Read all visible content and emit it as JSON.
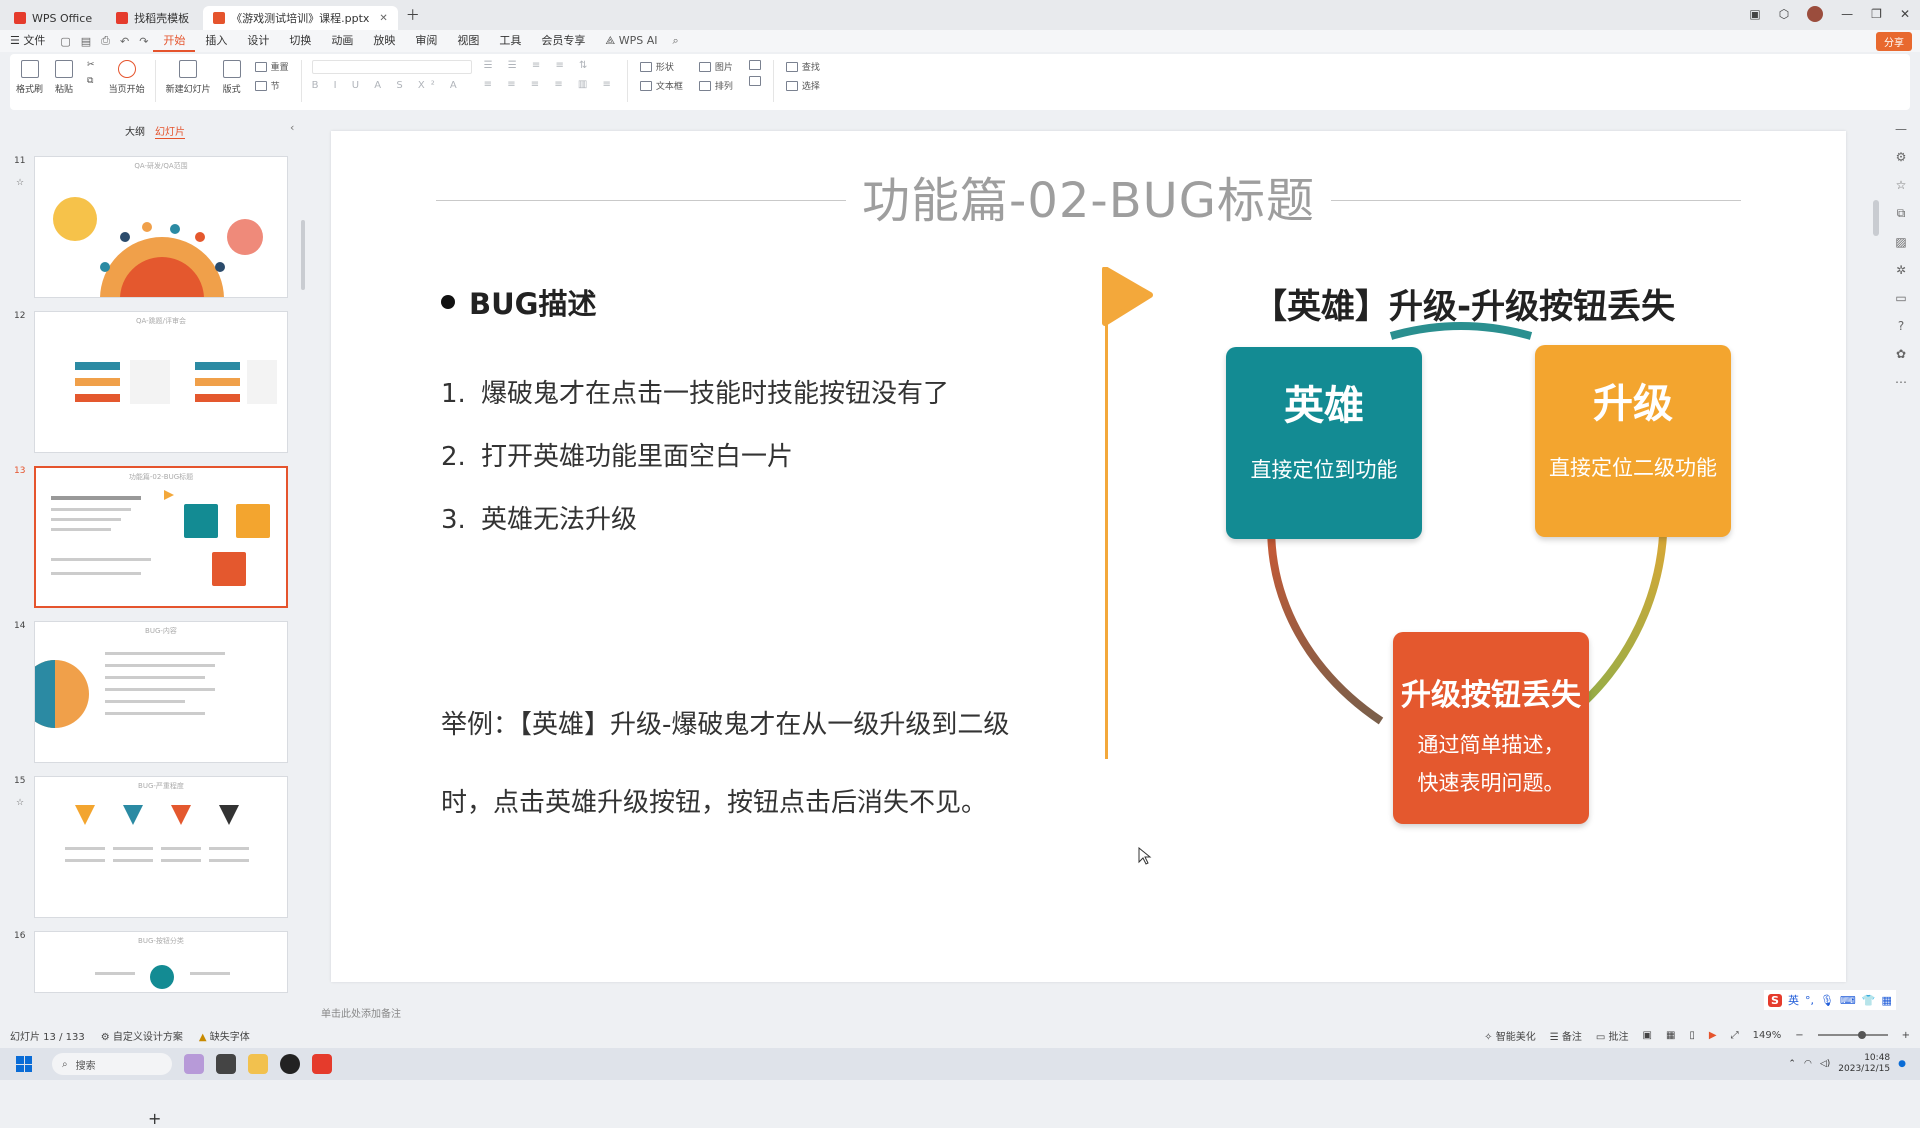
{
  "window": {
    "tabs": [
      {
        "label": "WPS Office",
        "color": "#e53b2c"
      },
      {
        "label": "找稻壳模板",
        "color": "#e53b2c"
      },
      {
        "label": "《游戏测试培训》课程.pptx",
        "color": "#e5542d",
        "active": true
      }
    ]
  },
  "menubar": {
    "file": "文件",
    "items": [
      "开始",
      "插入",
      "设计",
      "切换",
      "动画",
      "放映",
      "审阅",
      "视图",
      "工具",
      "会员专享"
    ],
    "active": "开始",
    "wps_ai": "WPS AI",
    "share": "分享"
  },
  "ribbon": {
    "format_painter": "格式刷",
    "paste": "粘贴",
    "play_from_current": "当页开始",
    "new_slide": "新建幻灯片",
    "layout": "版式",
    "reset": "重置",
    "section": "节",
    "shape": "形状",
    "picture": "图片",
    "textbox": "文本框",
    "arrange": "排列",
    "find": "查找",
    "select": "选择"
  },
  "leftpanel": {
    "tab_outline": "大纲",
    "tab_slides": "幻灯片",
    "thumbs": [
      {
        "num": "11",
        "title": "QA-研发/QA范围"
      },
      {
        "num": "12",
        "title": "QA-跳题/评审会"
      },
      {
        "num": "13",
        "title": "功能篇-02-BUG标题",
        "selected": true
      },
      {
        "num": "14",
        "title": "BUG-内容"
      },
      {
        "num": "15",
        "title": "BUG-严重程度"
      },
      {
        "num": "16",
        "title": "BUG-按钮分类"
      }
    ],
    "add": "+"
  },
  "slide": {
    "title": "功能篇-02-BUG标题",
    "bug_heading": "BUG描述",
    "items": [
      {
        "n": "1.",
        "text": "爆破鬼才在点击一技能时技能按钮没有了"
      },
      {
        "n": "2.",
        "text": "打开英雄功能里面空白一片"
      },
      {
        "n": "3.",
        "text": "英雄无法升级"
      }
    ],
    "example_line1": "举例：【英雄】升级-爆破鬼才在从一级升级到二级",
    "example_line2": "时，点击英雄升级按钮，按钮点击后消失不见。",
    "right_title": "【英雄】升级-升级按钮丢失",
    "cards": {
      "teal": {
        "title": "英雄",
        "sub": "直接定位到功能",
        "color": "#138b93"
      },
      "orange": {
        "title": "升级",
        "sub": "直接定位二级功能",
        "color": "#f3a52f"
      },
      "red": {
        "title": "升级按钮丢失",
        "sub1": "通过简单描述，",
        "sub2": "快速表明问题。",
        "color": "#e4582e"
      }
    }
  },
  "notes_placeholder": "单击此处添加备注",
  "status": {
    "slide_counter": "幻灯片 13 / 133",
    "design": "自定义设计方案",
    "missing_font": "缺失字体",
    "smart": "智能美化",
    "notes": "备注",
    "comments": "批注",
    "zoom": "149%"
  },
  "taskbar": {
    "search": "搜索",
    "time": "10:48",
    "date": "2023/12/15"
  },
  "ime": {
    "lang": "英"
  }
}
